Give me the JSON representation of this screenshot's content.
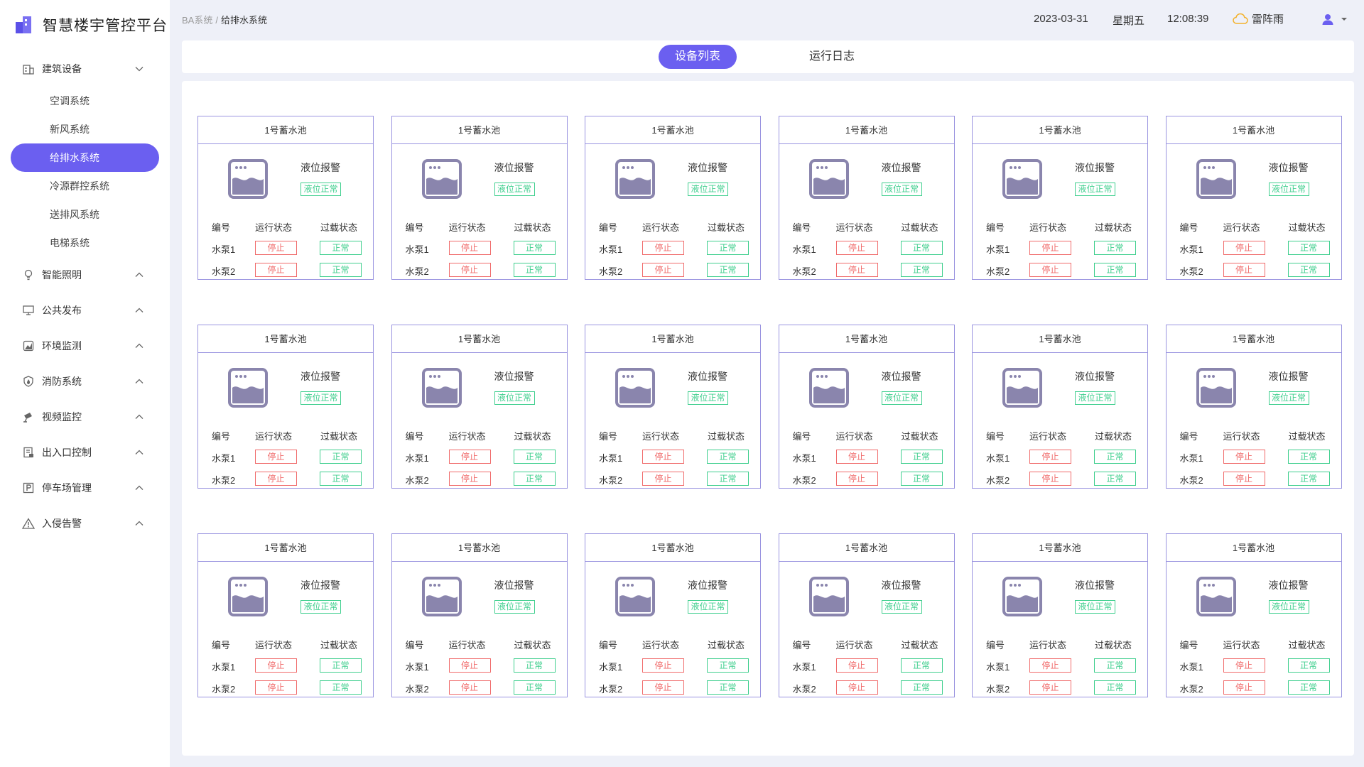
{
  "app": {
    "title": "智慧楼宇管控平台",
    "accent_color": "#6b5ff0"
  },
  "sidebar": {
    "groups": [
      {
        "label": "建筑设备",
        "icon": "building-icon",
        "expanded": true,
        "items": [
          "空调系统",
          "新风系统",
          "给排水系统",
          "冷源群控系统",
          "送排风系统",
          "电梯系统"
        ],
        "active_item": "给排水系统"
      },
      {
        "label": "智能照明",
        "icon": "bulb-icon"
      },
      {
        "label": "公共发布",
        "icon": "monitor-icon"
      },
      {
        "label": "环境监测",
        "icon": "environment-icon"
      },
      {
        "label": "消防系统",
        "icon": "fire-icon"
      },
      {
        "label": "视频监控",
        "icon": "camera-icon"
      },
      {
        "label": "出入口控制",
        "icon": "access-icon"
      },
      {
        "label": "停车场管理",
        "icon": "parking-icon"
      },
      {
        "label": "入侵告警",
        "icon": "warning-icon"
      }
    ]
  },
  "breadcrumb": {
    "prev": "BA系统",
    "sep": "/",
    "current": "给排水系统"
  },
  "header": {
    "date": "2023-03-31",
    "weekday": "星期五",
    "time": "12:08:39",
    "weather": "雷阵雨",
    "weather_icon": "cloud-icon",
    "user_icon": "user-icon"
  },
  "tabs": {
    "device_list": "设备列表",
    "run_log": "运行日志",
    "active": "设备列表"
  },
  "card_template": {
    "alarm_label": "液位报警",
    "alarm_status": "液位正常",
    "col_id": "编号",
    "col_run": "运行状态",
    "col_overload": "过载状态",
    "pump1": "水泵1",
    "pump2": "水泵2",
    "run_status": "停止",
    "overload_status": "正常"
  },
  "cards": [
    {
      "title": "1号蓄水池"
    },
    {
      "title": "1号蓄水池"
    },
    {
      "title": "1号蓄水池"
    },
    {
      "title": "1号蓄水池"
    },
    {
      "title": "1号蓄水池"
    },
    {
      "title": "1号蓄水池"
    },
    {
      "title": "1号蓄水池"
    },
    {
      "title": "1号蓄水池"
    },
    {
      "title": "1号蓄水池"
    },
    {
      "title": "1号蓄水池"
    },
    {
      "title": "1号蓄水池"
    },
    {
      "title": "1号蓄水池"
    },
    {
      "title": "1号蓄水池"
    },
    {
      "title": "1号蓄水池"
    },
    {
      "title": "1号蓄水池"
    },
    {
      "title": "1号蓄水池"
    },
    {
      "title": "1号蓄水池"
    },
    {
      "title": "1号蓄水池"
    }
  ]
}
